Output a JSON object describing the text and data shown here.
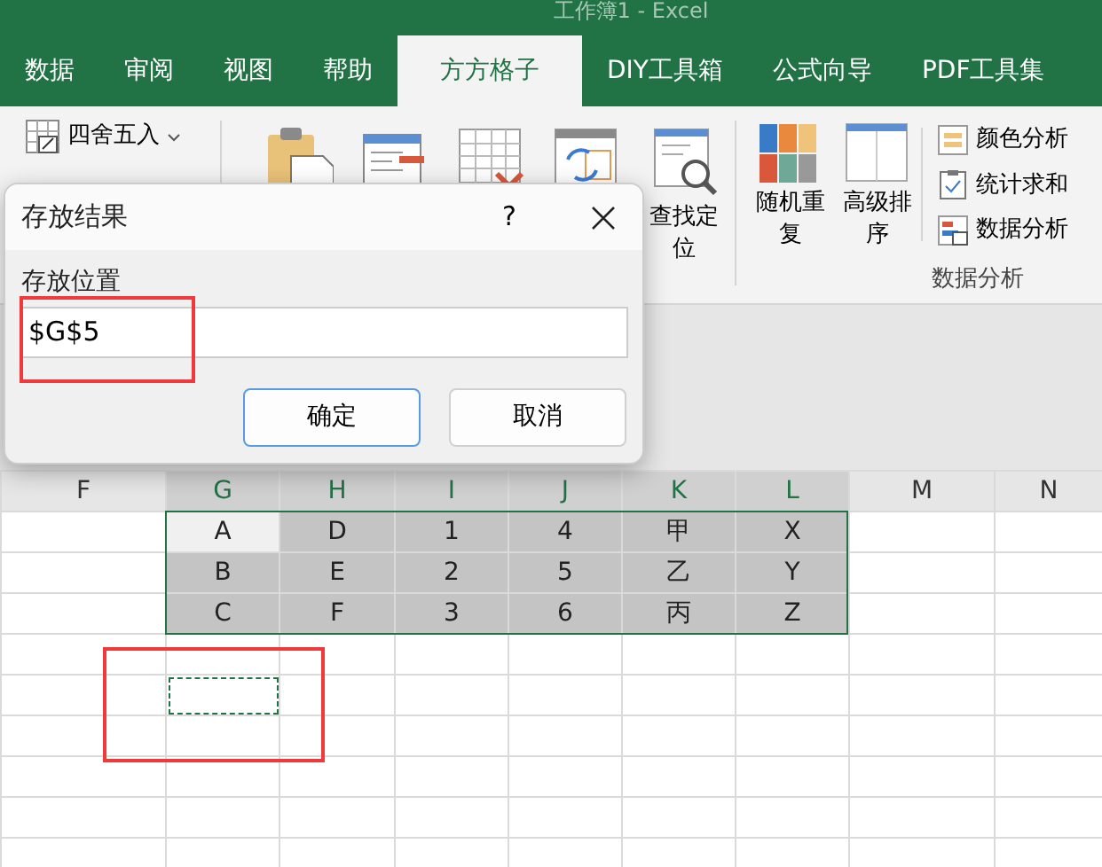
{
  "window": {
    "title": "工作簿1  -  Excel"
  },
  "tabs": [
    {
      "label": "数据",
      "selected": false
    },
    {
      "label": "审阅",
      "selected": false
    },
    {
      "label": "视图",
      "selected": false
    },
    {
      "label": "帮助",
      "selected": false
    },
    {
      "label": "方方格子",
      "selected": true
    },
    {
      "label": "DIY工具箱",
      "selected": false
    },
    {
      "label": "公式向导",
      "selected": false
    },
    {
      "label": "PDF工具集",
      "selected": false
    }
  ],
  "ribbon": {
    "number_items": [
      {
        "label": "四舍五入",
        "kind": "round"
      }
    ],
    "icon_buttons": [
      {
        "kind": "paste"
      },
      {
        "kind": "form"
      },
      {
        "kind": "delete-grid"
      },
      {
        "kind": "swap"
      }
    ],
    "find_button": {
      "label": "查找定位"
    },
    "analysis": {
      "buttons": [
        {
          "label": "随机重复",
          "kind": "tiles"
        },
        {
          "label": "高级排序",
          "kind": "sort"
        }
      ],
      "small_buttons": [
        {
          "label": "颜色分析",
          "kind": "color"
        },
        {
          "label": "统计求和",
          "kind": "sum"
        },
        {
          "label": "数据分析",
          "kind": "analysis"
        }
      ],
      "group_label": "数据分析"
    }
  },
  "dialog": {
    "title": "存放结果",
    "help": "?",
    "field_label": "存放位置",
    "value": "$G$5",
    "buttons": [
      {
        "label": "确定",
        "kind": "primary"
      },
      {
        "label": "取消",
        "kind": "secondary"
      }
    ]
  },
  "sheet": {
    "columns": [
      {
        "label": "F",
        "selected": false
      },
      {
        "label": "G",
        "selected": true
      },
      {
        "label": "H",
        "selected": true
      },
      {
        "label": "I",
        "selected": true
      },
      {
        "label": "J",
        "selected": true
      },
      {
        "label": "K",
        "selected": true
      },
      {
        "label": "L",
        "selected": true
      },
      {
        "label": "M",
        "selected": false
      },
      {
        "label": "N",
        "selected": false
      }
    ],
    "rows": [
      {
        "cells": [
          {
            "text": "A",
            "active": true
          },
          {
            "text": "D",
            "active": false
          },
          {
            "text": "1",
            "active": false
          },
          {
            "text": "4",
            "active": false
          },
          {
            "text": "甲",
            "active": false
          },
          {
            "text": "X",
            "active": false
          }
        ]
      },
      {
        "cells": [
          {
            "text": "B",
            "active": false
          },
          {
            "text": "E",
            "active": false
          },
          {
            "text": "2",
            "active": false
          },
          {
            "text": "5",
            "active": false
          },
          {
            "text": "乙",
            "active": false
          },
          {
            "text": "Y",
            "active": false
          }
        ]
      },
      {
        "cells": [
          {
            "text": "C",
            "active": false
          },
          {
            "text": "F",
            "active": false
          },
          {
            "text": "3",
            "active": false
          },
          {
            "text": "6",
            "active": false
          },
          {
            "text": "丙",
            "active": false
          },
          {
            "text": "Z",
            "active": false
          }
        ]
      },
      {
        "marquee": false
      },
      {
        "marquee": true
      }
    ]
  }
}
